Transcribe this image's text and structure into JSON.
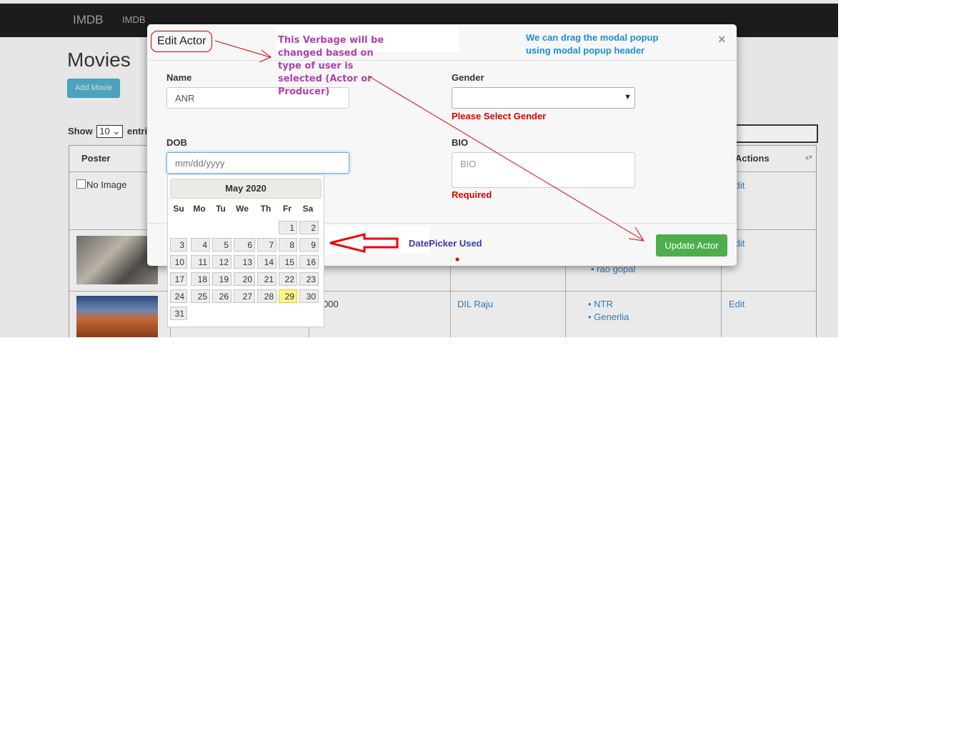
{
  "navbar": {
    "brand": "IMDB",
    "link": "IMDB"
  },
  "page": {
    "title": "Movies",
    "add_button": "Add Movie"
  },
  "table_controls": {
    "show_label": "Show",
    "page_size": "10",
    "entries_label": "entri"
  },
  "table": {
    "headers": [
      "Poster",
      "Actions"
    ],
    "rows": [
      {
        "poster": "No Image",
        "actions": "Edit"
      },
      {
        "actors": [
          "rao gopal"
        ],
        "actions": "Edit"
      },
      {
        "col2": "000",
        "producer": "DIL Raju",
        "actors": [
          "NTR",
          "Generlia"
        ],
        "actions": "Edit"
      }
    ]
  },
  "modal": {
    "title": "Edit Actor",
    "close": "×",
    "name_label": "Name",
    "name_value": "ANR",
    "gender_label": "Gender",
    "gender_error": "Please Select Gender",
    "dob_label": "DOB",
    "dob_placeholder": "mm/dd/yyyy",
    "bio_label": "BIO",
    "bio_placeholder": "BIO",
    "bio_error": "Required",
    "update_button": "Update Actor"
  },
  "datepicker": {
    "month_label": "May 2020",
    "weekdays": [
      "Su",
      "Mo",
      "Tu",
      "We",
      "Th",
      "Fr",
      "Sa"
    ],
    "days": [
      "1",
      "2",
      "3",
      "4",
      "5",
      "6",
      "7",
      "8",
      "9",
      "10",
      "11",
      "12",
      "13",
      "14",
      "15",
      "16",
      "17",
      "18",
      "19",
      "20",
      "21",
      "22",
      "23",
      "24",
      "25",
      "26",
      "27",
      "28",
      "29",
      "30",
      "31"
    ],
    "first_weekday_index": 5,
    "today": "29"
  },
  "annotations": {
    "verbage_note": "This Verbage will be changed based on type of user is selected (Actor or Producer)",
    "drag_note": "We can drag the modal popup using modal popup header",
    "datepicker_note": "DatePicker Used"
  },
  "colors": {
    "annotation_red": "#e00000",
    "annotation_purple": "#b040b0",
    "annotation_blue": "#1a8fd8",
    "update_button": "#4cae4c"
  }
}
